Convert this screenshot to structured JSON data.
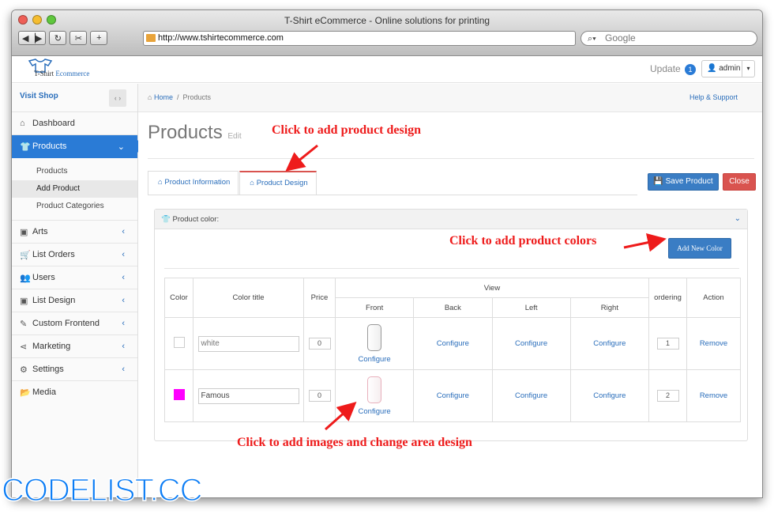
{
  "window": {
    "title": "T-Shirt eCommerce - Online solutions for printing"
  },
  "browser": {
    "url": "http://www.tshirtecommerce.com",
    "search_placeholder": "Google"
  },
  "topbar": {
    "logo_text_a": "T-Shirt ",
    "logo_text_b": "Ecommerce",
    "update_label": "Update",
    "update_count": "1",
    "user": "admin"
  },
  "sidebar": {
    "visit_shop": "Visit Shop",
    "items": [
      {
        "label": "Dashboard",
        "icon": "home-icon"
      },
      {
        "label": "Products",
        "icon": "tshirt-icon"
      },
      {
        "label": "Arts",
        "icon": "image-icon"
      },
      {
        "label": "List Orders",
        "icon": "cart-icon"
      },
      {
        "label": "Users",
        "icon": "users-icon"
      },
      {
        "label": "List Design",
        "icon": "image-icon"
      },
      {
        "label": "Custom Frontend",
        "icon": "pencil-icon"
      },
      {
        "label": "Marketing",
        "icon": "share-icon"
      },
      {
        "label": "Settings",
        "icon": "gear-icon"
      },
      {
        "label": "Media",
        "icon": "folder-icon"
      }
    ],
    "sub_items": [
      "Products",
      "Add Product",
      "Product Categories"
    ]
  },
  "breadcrumb": {
    "home": "Home",
    "current": "Products",
    "help": "Help & Support"
  },
  "page": {
    "title": "Products",
    "subtitle": "Edit"
  },
  "tabs": [
    "Product Information",
    "Product Design"
  ],
  "actions": {
    "save": "Save Product",
    "close": "Close"
  },
  "panel": {
    "title": "Product color:",
    "add_color": "Add New Color"
  },
  "table": {
    "headers": {
      "color": "Color",
      "color_title": "Color title",
      "price": "Price",
      "view": "View",
      "ordering": "ordering",
      "action": "Action"
    },
    "view_headers": [
      "Front",
      "Back",
      "Left",
      "Right"
    ],
    "configure": "Configure",
    "remove": "Remove",
    "rows": [
      {
        "swatch": "#ffffff",
        "title": "white",
        "price": "0",
        "ordering": "1"
      },
      {
        "swatch": "#ff00ff",
        "title": "Famous",
        "price": "0",
        "ordering": "2"
      }
    ]
  },
  "annotations": {
    "design": "Click to add product design",
    "colors": "Click to add product colors",
    "images": "Click to add images and change area design"
  },
  "watermark": "CODELIST.CC"
}
